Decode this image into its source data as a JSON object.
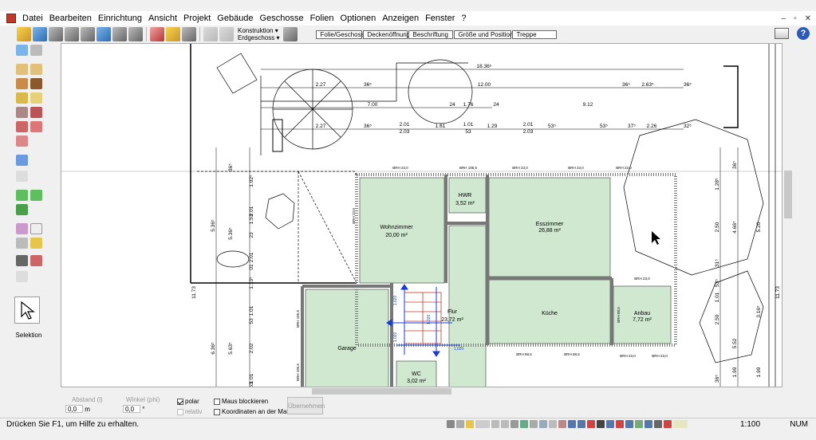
{
  "menu": [
    "Datei",
    "Bearbeiten",
    "Einrichtung",
    "Ansicht",
    "Projekt",
    "Gebäude",
    "Geschosse",
    "Folien",
    "Optionen",
    "Anzeigen",
    "Fenster",
    "?"
  ],
  "toolbar": {
    "konstruktion": "Konstruktion ▾",
    "erdgeschoss": "Erdgeschoss ▾",
    "tabs": [
      "Folie/Geschoss",
      "Deckenöffnung",
      "Beschriftung",
      "Größe und Position",
      "Treppe"
    ]
  },
  "help": "?",
  "left_panel": {
    "selection_label": "Selektion"
  },
  "plan": {
    "rooms": [
      {
        "name": "Wohnzimmer",
        "area": "20,00 m²"
      },
      {
        "name": "HWR",
        "area": "3,52 m²"
      },
      {
        "name": "Esszimmer",
        "area": "26,88 m²"
      },
      {
        "name": "Flur",
        "area": "23,72 m²"
      },
      {
        "name": "Küche",
        "area": ""
      },
      {
        "name": "Anbau",
        "area": "7,72 m²"
      },
      {
        "name": "Garage",
        "area": ""
      },
      {
        "name": "WC",
        "area": "3,02 m²"
      }
    ],
    "top_dims": [
      "18.36⁵",
      "12.00",
      "2.27",
      "36⁵",
      "7.00",
      "24",
      "1.76",
      "24",
      "9.12",
      "36⁵",
      "2.63⁵",
      "36⁵",
      "2.27",
      "36⁵",
      "2.01",
      "2.03",
      "1.61",
      "1.01",
      "53",
      "1.29",
      "2.01",
      "2.03",
      "53⁵",
      "53⁵",
      "37⁵",
      "2.26",
      "32⁵"
    ],
    "left_dims": [
      "5.36⁵",
      "5.36⁵",
      "11.73",
      "6.36⁵",
      "5.63⁵",
      "36⁵",
      "1.02⁵",
      "2.01",
      "1.53",
      "23",
      "2.01",
      "01",
      "1.13⁵",
      "1.01",
      "53",
      "2.02",
      "1.01",
      "53"
    ],
    "right_dims": [
      "36⁵",
      "1.28⁵",
      "2.50",
      "4.66⁵",
      "5.20",
      "31⁵",
      "53⁵",
      "1.01",
      "11.73",
      "3.16⁵",
      "2.50",
      "5.52",
      "1.99",
      "1.99",
      "36⁵"
    ],
    "brh": [
      "BRH 23,0",
      "BRH 185,5",
      "BRH 23,0",
      "BRH 23,0",
      "BRH 23,0",
      "BRH 88,5",
      "BRH 88,5",
      "BRH 23,0",
      "BRH 23,0",
      "BRH 23,0",
      "BRH 23,0",
      "BRH 185,5",
      "BRH 185,5",
      "BRH 88,5"
    ],
    "stair_dims": [
      "1.020",
      "1.020",
      "1.020",
      "1,020"
    ]
  },
  "bottom": {
    "abstand": "Abstand (l)",
    "winkel": "Winkel (phi)",
    "abstand_val": "0,0",
    "winkel_val": "0,0",
    "unit_m": "m",
    "unit_deg": "°",
    "polar": "polar",
    "relativ": "relativ",
    "maus": "Maus blockieren",
    "koord": "Koordinaten an der Maus",
    "uebernehmen": "Übernehmen"
  },
  "status": {
    "text": "Drücken Sie F1, um Hilfe zu erhalten.",
    "scale": "1:100",
    "mode": "NUM"
  }
}
